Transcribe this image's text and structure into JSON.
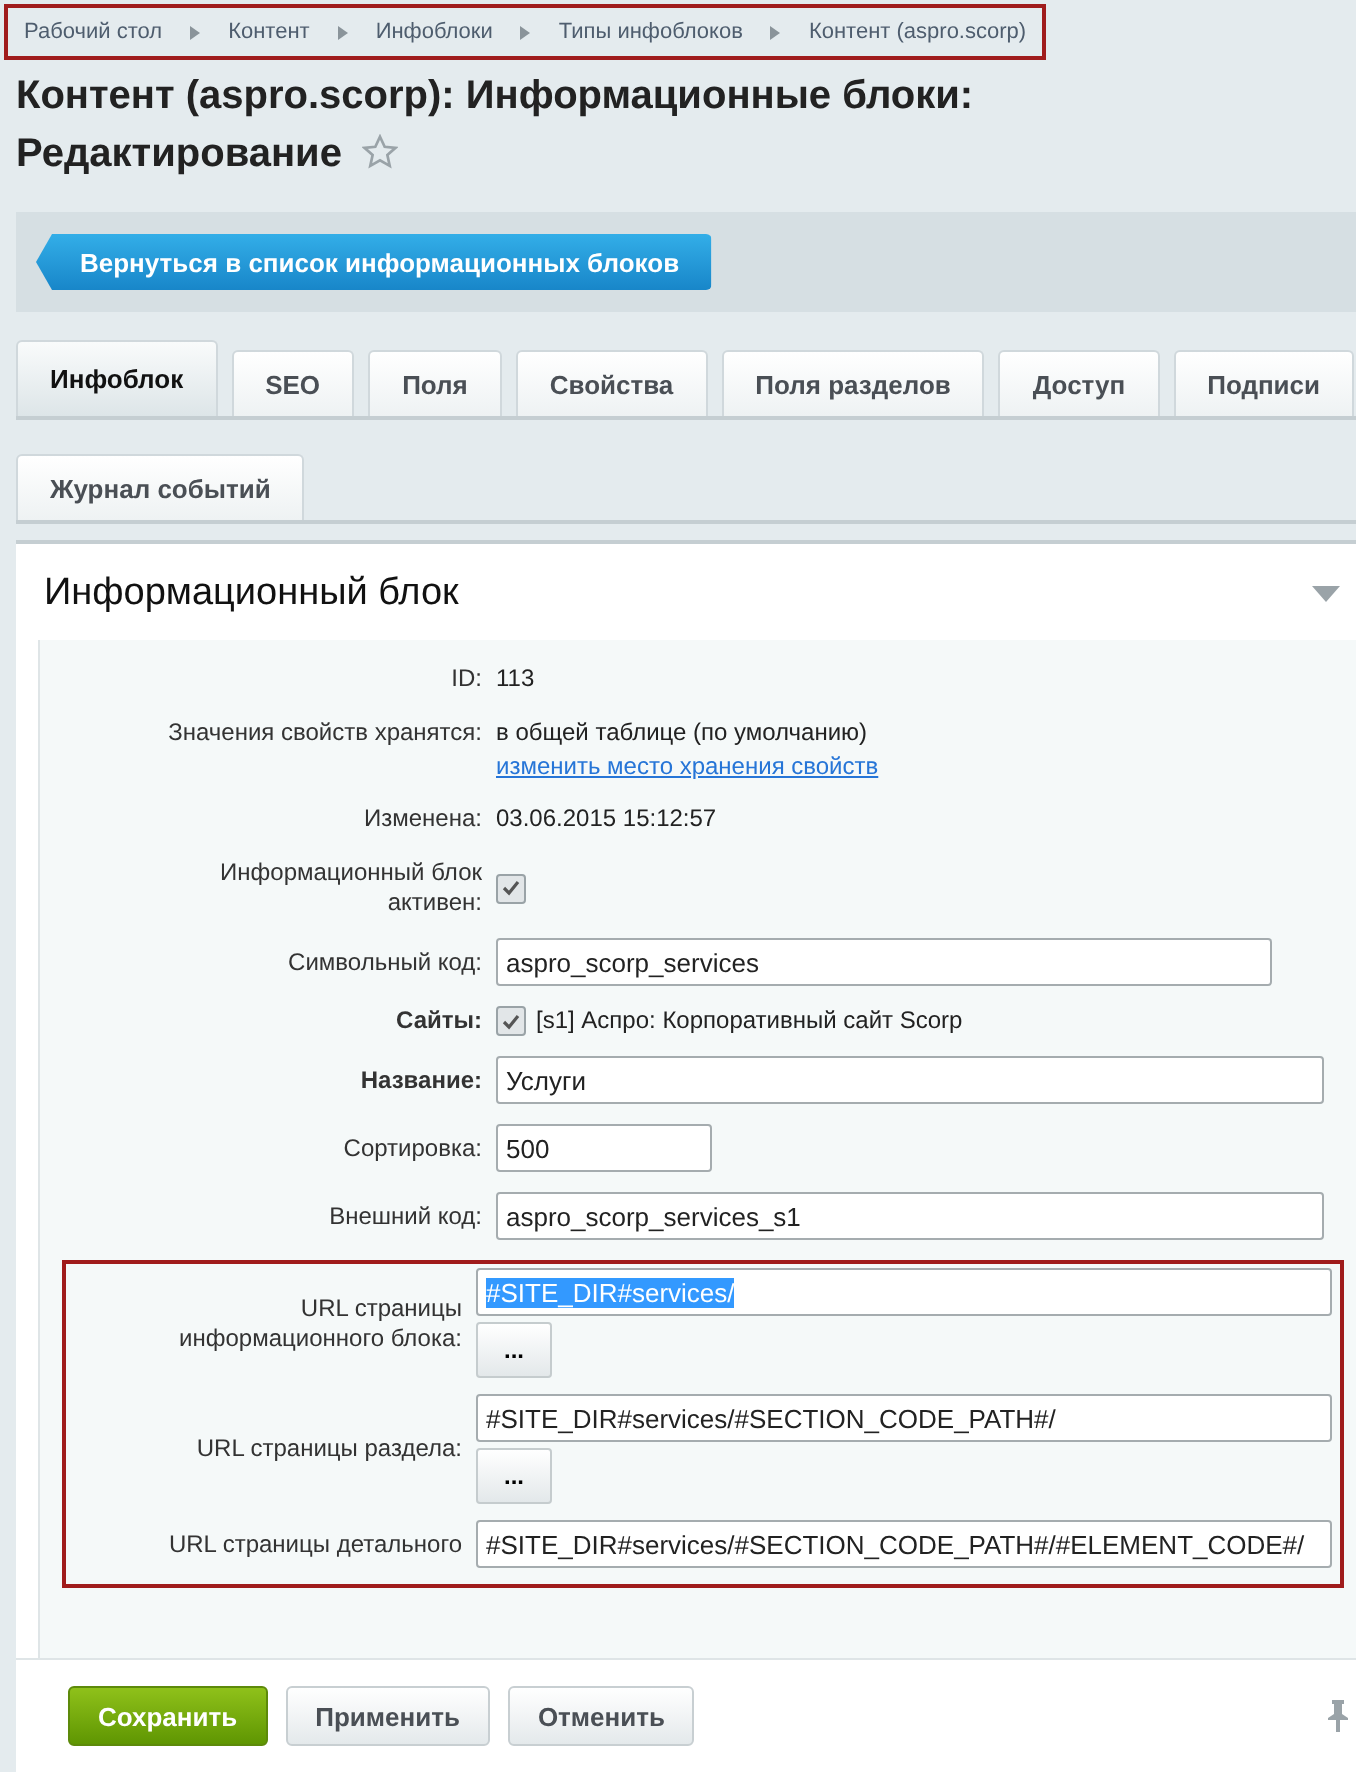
{
  "breadcrumbs": {
    "highlighted": true,
    "items": [
      "Рабочий стол",
      "Контент",
      "Инфоблоки",
      "Типы инфоблоков",
      "Контент (aspro.scorp)"
    ]
  },
  "title": "Контент (aspro.scorp): Информационные блоки: Редактирование",
  "favorite": false,
  "back_button": "Вернуться в список информационных блоков",
  "tabs": [
    {
      "label": "Инфоблок",
      "selected": true
    },
    {
      "label": "SEO",
      "selected": false
    },
    {
      "label": "Поля",
      "selected": false
    },
    {
      "label": "Свойства",
      "selected": false
    },
    {
      "label": "Поля разделов",
      "selected": false
    },
    {
      "label": "Доступ",
      "selected": false
    },
    {
      "label": "Подписи",
      "selected": false
    }
  ],
  "tabs_row2": [
    {
      "label": "Журнал событий",
      "selected": false
    }
  ],
  "section": {
    "title": "Информационный блок",
    "expanded": true
  },
  "fields": [
    {
      "kind": "text",
      "label": "ID:",
      "value": "113"
    },
    {
      "kind": "text",
      "label": "Значения свойств хранятся:",
      "value": "в общей таблице (по умолчанию)",
      "link": "изменить место хранения свойств"
    },
    {
      "kind": "text",
      "label": "Изменена:",
      "value": "03.06.2015 15:12:57"
    },
    {
      "kind": "checkbox",
      "label": "Информационный блок активен:",
      "checked": true
    },
    {
      "kind": "input_long",
      "label": "Символьный код:",
      "value": "aspro_scorp_services"
    },
    {
      "kind": "checkbox",
      "label": "Сайты:",
      "required": true,
      "checked": true,
      "value": "[s1] Аспро: Корпоративный сайт Scorp"
    },
    {
      "kind": "input",
      "label": "Название:",
      "required": true,
      "value": "Услуги"
    },
    {
      "kind": "input_short",
      "label": "Сортировка:",
      "value": "500"
    },
    {
      "kind": "input",
      "label": "Внешний код:",
      "value": "aspro_scorp_services_s1"
    }
  ],
  "url_group": {
    "highlighted": true,
    "fields": [
      {
        "label": "URL страницы информационного блока:",
        "value": "#SITE_DIR#services/",
        "value_selected": true,
        "button": "..."
      },
      {
        "label": "URL страницы раздела:",
        "value": "#SITE_DIR#services/#SECTION_CODE_PATH#/",
        "value_selected": false,
        "button": "..."
      },
      {
        "label": "URL страницы детального",
        "value": "#SITE_DIR#services/#SECTION_CODE_PATH#/#ELEMENT_CODE#/",
        "value_selected": false
      }
    ]
  },
  "footer_buttons": [
    {
      "label": "Сохранить",
      "kind": "primary"
    },
    {
      "label": "Применить",
      "kind": "default"
    },
    {
      "label": "Отменить",
      "kind": "default"
    }
  ],
  "footer_pinned": true
}
